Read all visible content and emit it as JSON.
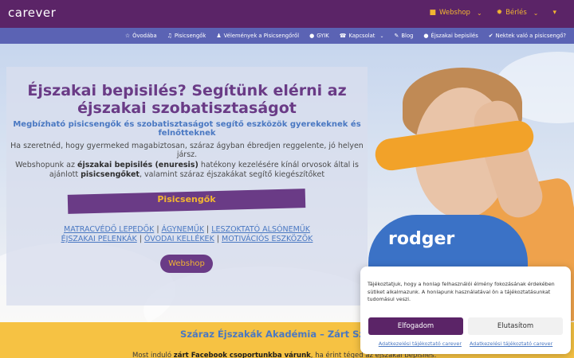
{
  "header": {
    "logo": "carever",
    "links": [
      {
        "icon": "shopping-bag-icon",
        "label": "Webshop"
      },
      {
        "icon": "gear-icon",
        "label": "Bérlés"
      },
      {
        "icon": "cart-icon",
        "label": ""
      }
    ]
  },
  "nav": {
    "items": [
      {
        "icon": "star-icon",
        "label": "Óvodába"
      },
      {
        "icon": "music-icon",
        "label": "Pisicsengők"
      },
      {
        "icon": "user-icon",
        "label": "Vélemények a Pisicsengőről"
      },
      {
        "icon": "info-icon",
        "label": "GYIK"
      },
      {
        "icon": "phone-icon",
        "label": "Kapcsolat"
      },
      {
        "icon": "blog-icon",
        "label": "Blog"
      },
      {
        "icon": "info-icon",
        "label": "Éjszakai bepisilés"
      },
      {
        "icon": "check-icon",
        "label": "Nektek való a pisicsengő?"
      }
    ]
  },
  "hero": {
    "title": "Éjszakai bepisilés? Segítünk elérni az éjszakai szobatisztaságot",
    "subtitle": "Megbízható pisicsengők és szobatisztaságot segítő eszközök gyerekeknek és felnőtteknek",
    "p1": "Ha szeretnéd, hogy gyermeked magabiztosan, száraz ágyban ébredjen reggelente, jó helyen jársz.",
    "p2_a": "Webshopunk az ",
    "p2_b": "éjszakai bepisilés (enuresis)",
    "p2_c": " hatékony kezelésére kínál orvosok által is ajánlott ",
    "p2_d": "pisicsengőket",
    "p2_e": ", valamint száraz éjszakákat segítő kiegészítőket",
    "banner": "Pisicsengők",
    "links_row1": [
      "MATRACVÉDŐ LEPEDŐK",
      "ÁGYNEMŰK",
      "LESZOKTATÓ ALSÓNEMŰK"
    ],
    "links_row2": [
      "ÉJSZAKAI PELENKÁK",
      "ÓVODAI KELLÉKEK",
      "MOTIVÁCIÓS ESZKÖZÖK"
    ],
    "button": "Webshop",
    "shirt_text": "rodger"
  },
  "academy": {
    "title": "Száraz Éjszakák Akadémia – Zárt Szülői K",
    "text_a": "Most induló ",
    "text_b": "zárt Facebook csoportunkba várunk",
    "text_c": ", ha érint téged az éjszakai bepisilés."
  },
  "cookie": {
    "text": "Tájékoztatjuk, hogy a honlap felhasználói élmény fokozásának érdekében sütiket alkalmazunk. A honlapunk használatával ön a tájékoztatásunkat tudomásul veszi.",
    "accept": "Elfogadom",
    "deny": "Elutasítom",
    "links": [
      "Adatkezelési tájékoztató carever",
      "Adatkezelési tájékoztató carever"
    ]
  },
  "colors": {
    "topbar": "#5b2467",
    "navbar": "#5b63b4",
    "accent": "#f2b531",
    "purple": "#6a3b86",
    "blue_text": "#4a78c2",
    "yellow": "#f6c243"
  }
}
